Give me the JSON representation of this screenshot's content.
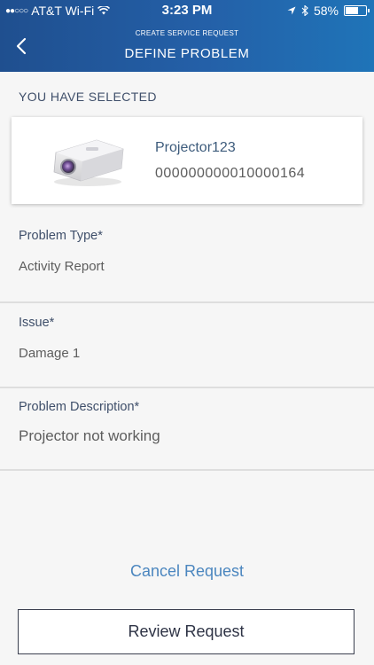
{
  "status_bar": {
    "carrier": "AT&T Wi-Fi",
    "time": "3:23 PM",
    "battery": "58%",
    "battery_level": 0.58
  },
  "header": {
    "subtitle": "CREATE SERVICE REQUEST",
    "title": "DEFINE PROBLEM"
  },
  "selected": {
    "label": "YOU HAVE SELECTED",
    "name": "Projector123",
    "code": "000000000010000164"
  },
  "fields": [
    {
      "label": "Problem Type*",
      "value": "Activity Report"
    },
    {
      "label": "Issue*",
      "value": "Damage 1"
    },
    {
      "label": "Problem Description*",
      "value": "Projector not working"
    }
  ],
  "actions": {
    "cancel": "Cancel Request",
    "review": "Review Request"
  },
  "colors": {
    "header": "#2460a8",
    "link": "#4b86bf",
    "label": "#3f4f6a"
  }
}
